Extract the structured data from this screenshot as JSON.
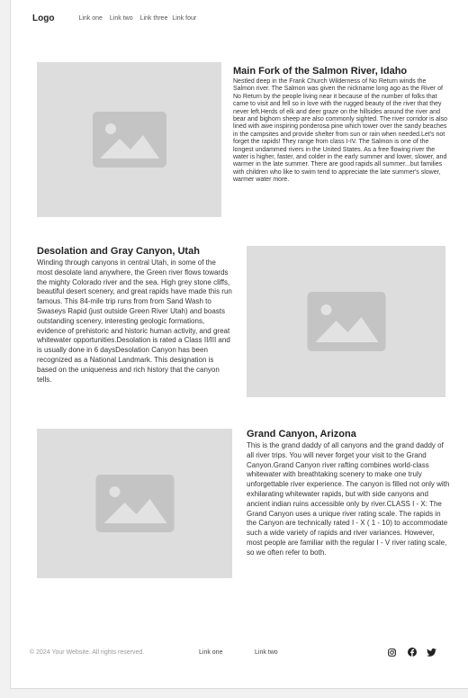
{
  "header": {
    "logo": "Logo",
    "links": [
      "Link one",
      "Link two",
      "Link three",
      "Link four"
    ]
  },
  "sections": [
    {
      "title": "Main Fork of the Salmon River, Idaho",
      "body": "Nestled deep in the Frank Church Wilderness of No Return winds the Salmon river. The Salmon was given the nickname long ago as the River of No Return by the people living near it because of the number of folks that came to visit and fell so in love with the rugged beauty of the river that they never left.Herds of elk and deer graze on the hillsides around the river and bear and bighorn sheep are also commonly sighted. The river corridor is also lined with awe inspiring ponderosa pine which tower over the sandy beaches in the campsites and provide shelter from sun or rain when needed.Let's not forget the rapids! They range from class I-IV. The Salmon is one of the longest undammed rivers in the United States. As a free flowing river the water is higher, faster, and colder in the early summer and lower, slower, and warmer in the late summer. There are good rapids all summer...but families with children who like to swim tend to appreciate the late summer's slower, warmer water more.",
      "image_icon": "image-placeholder-icon"
    },
    {
      "title": "Desolation and Gray Canyon, Utah",
      "body": "Winding through canyons in central Utah, in some of the most desolate land anywhere, the Green river flows towards the mighty Colorado river and the sea. High grey stone cliffs, beautiful desert scenery, and great rapids have made this run famous. This 84-mile trip runs from from Sand Wash to Swaseys Rapid (just outside Green River Utah) and boasts outstanding scenery, interesting geologic formations, evidence of prehistoric and historic human activity, and great whitewater opportunities.Desolation is rated a Class II/III and is usually done in 6 daysDesolation Canyon has been recognized as a National Landmark.  This designation is based on the uniqueness and rich history that the canyon tells.",
      "image_icon": "image-placeholder-icon"
    },
    {
      "title": "Grand Canyon, Arizona",
      "body": "This is the grand daddy of all canyons and the grand daddy of all river trips. You will never forget your visit to the Grand Canyon.Grand Canyon river rafting combines world-class whitewater with breathtaking scenery to make one truly unforgettable river experience. The canyon is filled not only with exhilarating whitewater rapids, but with side canyons and ancient indian ruins accessible only by river.CLASS I - X: The Grand Canyon uses a unique river rating scale. The rapids in the Canyon are technically rated I - X ( 1 - 10) to accommodate such a wide variety of rapids and river variances. However, most people are familiar with the regular I - V river rating scale, so we often refer to both.",
      "image_icon": "image-placeholder-icon"
    }
  ],
  "footer": {
    "copyright": "© 2024 Your Website. All rights reserved.",
    "links": [
      "Link one",
      "Link two"
    ],
    "social_icons": [
      "instagram-icon",
      "facebook-icon",
      "twitter-icon"
    ]
  },
  "colors": {
    "placeholder_bg": "#dddddd",
    "placeholder_icon": "#c4c4c4",
    "text": "#333333"
  }
}
